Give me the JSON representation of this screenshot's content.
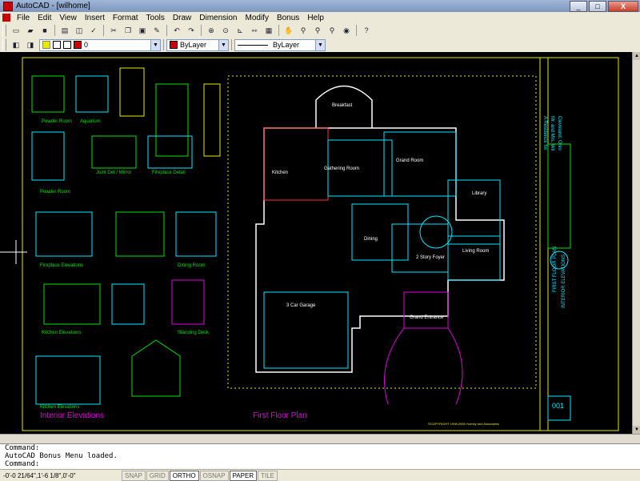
{
  "window": {
    "title": "AutoCAD - [wilhome]",
    "minimize": "_",
    "maximize": "□",
    "close": "X"
  },
  "menu": [
    "File",
    "Edit",
    "View",
    "Insert",
    "Format",
    "Tools",
    "Draw",
    "Dimension",
    "Modify",
    "Bonus",
    "Help"
  ],
  "toolbar": {
    "layer_value": "0",
    "color_value": "ByLayer",
    "linetype_value": "ByLayer",
    "help_label": "?"
  },
  "drawing": {
    "sheet_title_left": "Interior Elevations",
    "sheet_title_right": "First Floor Plan",
    "left_labels": [
      "Powder Room",
      "Aquarium",
      "Joint Det / Mirror",
      "Fireplace Detail",
      "Powder Room",
      "Fireplace Elevations",
      "Dining Room",
      "Kitchen Elevations",
      "Standing Desk",
      "Kitchen Elevations"
    ],
    "room_labels": [
      "Breakfast",
      "Gathering Room",
      "Grand Room",
      "Kitchen",
      "Dining",
      "Library",
      "2 Story Foyer",
      "Living Room",
      "3 Car Garage",
      "Grand Entrance"
    ],
    "title_block": [
      "A Residence for",
      "Mr. and Mrs. Wil",
      "Cleveland, Ohio",
      "FIRST FLOOR PLAN",
      "INTERIOR ELEVATIONS",
      "001"
    ],
    "copyright": "©COPYRIGHT 1998,2006 Hornby and Associates"
  },
  "command": {
    "lines": [
      "Command:",
      "AutoCAD Bonus Menu loaded.",
      "Command:"
    ]
  },
  "status": {
    "coords": "-0'-0 21/64\",1'-6 1/8\",0'-0\"",
    "buttons": [
      {
        "label": "SNAP",
        "on": false
      },
      {
        "label": "GRID",
        "on": false
      },
      {
        "label": "ORTHO",
        "on": true
      },
      {
        "label": "OSNAP",
        "on": false
      },
      {
        "label": "PAPER",
        "on": true
      },
      {
        "label": "TILE",
        "on": false
      }
    ]
  },
  "colors": {
    "yellow": "#e8e800",
    "cyan": "#00e8ff",
    "green": "#00e000",
    "magenta": "#e000e0",
    "red": "#ff3030",
    "white": "#ffffff"
  }
}
